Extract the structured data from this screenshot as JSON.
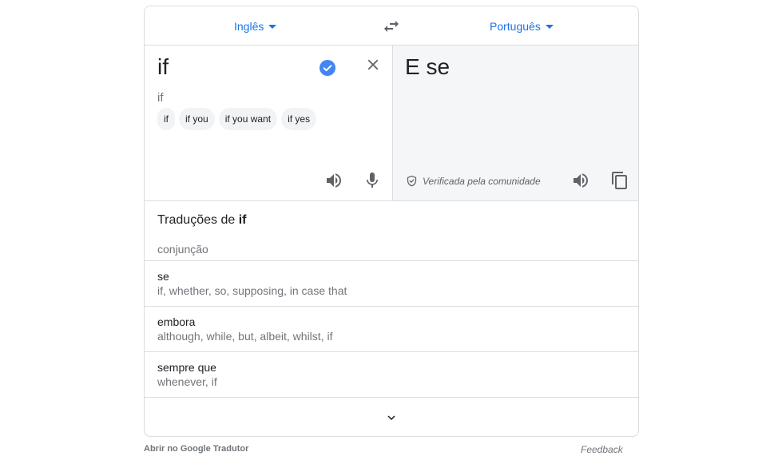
{
  "languages": {
    "source": "Inglês",
    "target": "Português"
  },
  "source": {
    "text": "if",
    "transliteration": "if",
    "suggestions": [
      "if",
      "if you",
      "if you want",
      "if yes"
    ]
  },
  "target": {
    "text": "E se",
    "verified_label": "Verificada pela comunidade"
  },
  "dictionary": {
    "title_prefix": "Traduções de",
    "title_word": "if",
    "part_of_speech": "conjunção",
    "entries": [
      {
        "word": "se",
        "synonyms": "if, whether, so, supposing, in case that"
      },
      {
        "word": "embora",
        "synonyms": "although, while, but, albeit, whilst, if"
      },
      {
        "word": "sempre que",
        "synonyms": "whenever, if"
      }
    ]
  },
  "footer": {
    "open_label": "Abrir no Google Tradutor",
    "feedback_label": "Feedback"
  },
  "icons": {
    "caret": "caret-down-icon",
    "swap": "swap-icon",
    "verified": "verified-check-icon",
    "clear": "close-icon",
    "speaker": "speaker-icon",
    "mic": "mic-icon",
    "shield": "shield-check-icon",
    "copy": "copy-icon",
    "expand": "chevron-down-icon"
  },
  "colors": {
    "accent": "#1a73e8",
    "verified": "#4285f4",
    "target_bg": "#f5f6f8",
    "border": "#dadce0"
  }
}
